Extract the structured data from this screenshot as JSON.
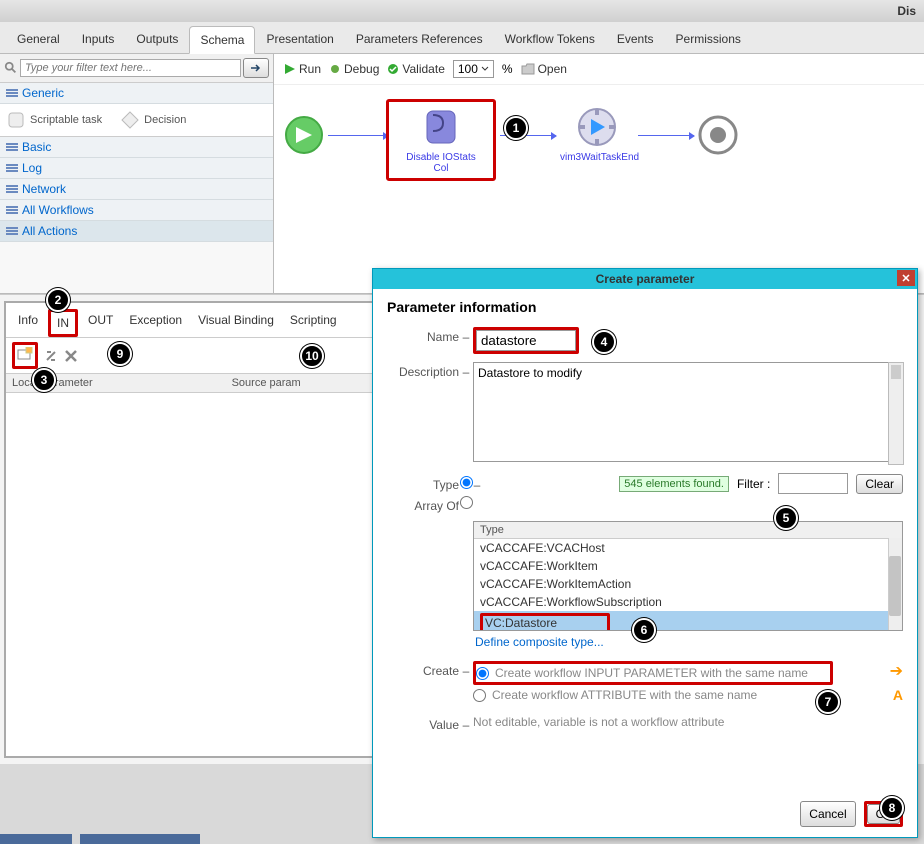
{
  "window_title": "Dis",
  "tabs": [
    "General",
    "Inputs",
    "Outputs",
    "Schema",
    "Presentation",
    "Parameters References",
    "Workflow Tokens",
    "Events",
    "Permissions"
  ],
  "active_tab": "Schema",
  "filter_placeholder": "Type your filter text here...",
  "categories": [
    "Generic",
    "Basic",
    "Log",
    "Network",
    "All Workflows",
    "All Actions"
  ],
  "palette": {
    "scriptable": "Scriptable task",
    "decision": "Decision"
  },
  "toolbar": {
    "run": "Run",
    "debug": "Debug",
    "validate": "Validate",
    "zoom": "100",
    "pct": "%",
    "open": "Open"
  },
  "flow": {
    "node1": "Disable IOStats Col",
    "node2": "vim3WaitTaskEnd"
  },
  "subtabs": [
    "Info",
    "IN",
    "OUT",
    "Exception",
    "Visual Binding",
    "Scripting"
  ],
  "cols": {
    "local": "Local Parameter",
    "source": "Source param"
  },
  "dialog": {
    "title": "Create parameter",
    "heading": "Parameter information",
    "labels": {
      "name": "Name",
      "desc": "Description",
      "type": "Type",
      "arrayof": "Array Of",
      "filter": "Filter :",
      "create": "Create",
      "value": "Value"
    },
    "name_value": "datastore",
    "desc_value": "Datastore to modify",
    "found": "545 elements found.",
    "clear": "Clear",
    "type_header": "Type",
    "types": [
      "vCACCAFE:VCACHost",
      "vCACCAFE:WorkItem",
      "vCACCAFE:WorkItemAction",
      "vCACCAFE:WorkflowSubscription",
      "VC:Datastore"
    ],
    "define_composite": "Define composite type...",
    "create_opt1": "Create workflow INPUT PARAMETER with the same name",
    "create_opt2": "Create workflow ATTRIBUTE with the same name",
    "value_text": "Not editable, variable is not a workflow attribute",
    "cancel": "Cancel",
    "ok": "Ok"
  }
}
